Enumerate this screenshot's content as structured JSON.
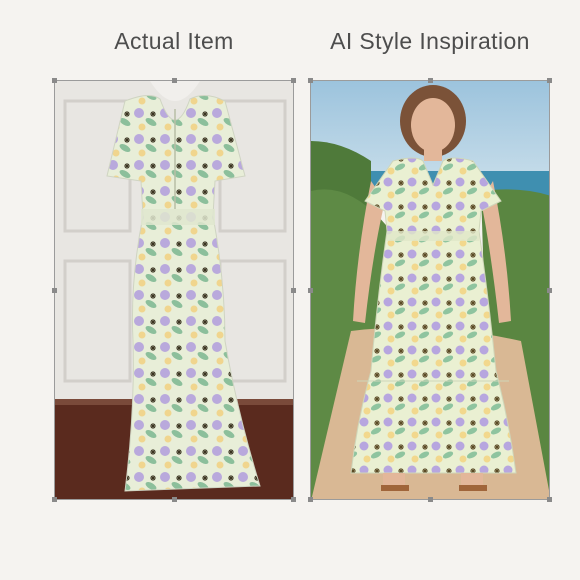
{
  "captions": {
    "left": "Actual Item",
    "right": "AI Style Inspiration"
  },
  "colors": {
    "background": "#f5f3f0",
    "caption_text": "#4d4d4d",
    "door": "#e8e6e2",
    "floor": "#5a2a1e",
    "sky": "#a9cbe0",
    "sea": "#3f8fb0",
    "grass": "#4f7a3a",
    "sand": "#d9b894",
    "dress_base": "#e6ecd6"
  },
  "icons": [
    "frame-selection-handle"
  ]
}
